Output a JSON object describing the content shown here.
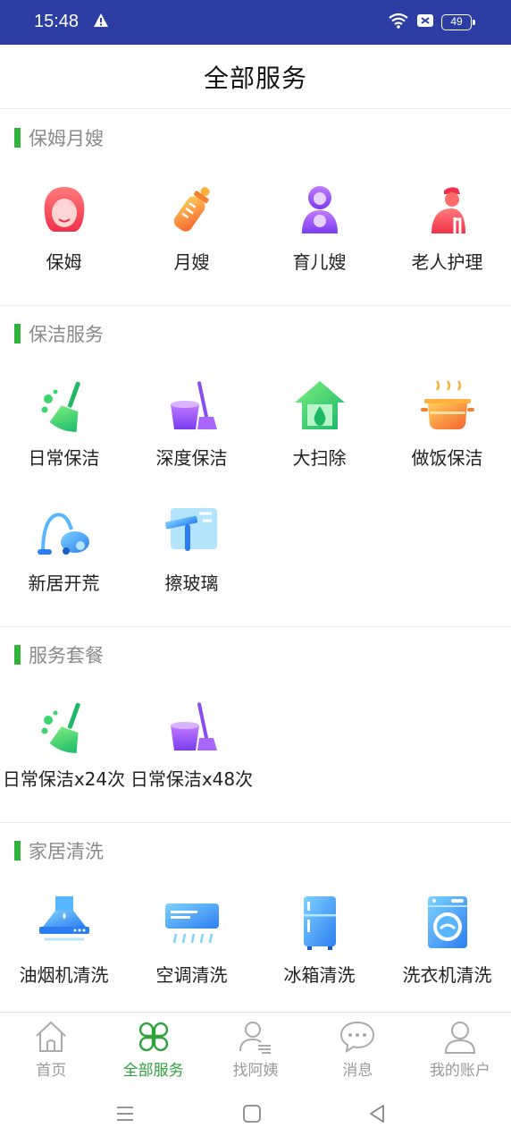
{
  "status": {
    "time": "15:48",
    "battery": "49"
  },
  "page": {
    "title": "全部服务"
  },
  "sections": [
    {
      "title": "保姆月嫂",
      "items": [
        {
          "label": "保姆",
          "icon": "nanny-icon"
        },
        {
          "label": "月嫂",
          "icon": "baby-bottle-icon"
        },
        {
          "label": "育儿嫂",
          "icon": "childcare-icon"
        },
        {
          "label": "老人护理",
          "icon": "elderly-care-icon"
        }
      ]
    },
    {
      "title": "保洁服务",
      "items": [
        {
          "label": "日常保洁",
          "icon": "broom-icon"
        },
        {
          "label": "深度保洁",
          "icon": "bucket-mop-icon"
        },
        {
          "label": "大扫除",
          "icon": "house-drop-icon"
        },
        {
          "label": "做饭保洁",
          "icon": "cooking-pot-icon"
        },
        {
          "label": "新居开荒",
          "icon": "vacuum-icon"
        },
        {
          "label": "擦玻璃",
          "icon": "window-squeegee-icon"
        }
      ]
    },
    {
      "title": "服务套餐",
      "items": [
        {
          "label": "日常保洁x24次",
          "icon": "broom-icon"
        },
        {
          "label": "日常保洁x48次",
          "icon": "bucket-mop-icon"
        }
      ]
    },
    {
      "title": "家居清洗",
      "items": [
        {
          "label": "油烟机清洗",
          "icon": "range-hood-icon"
        },
        {
          "label": "空调清洗",
          "icon": "air-conditioner-icon"
        },
        {
          "label": "冰箱清洗",
          "icon": "fridge-icon"
        },
        {
          "label": "洗衣机清洗",
          "icon": "washing-machine-icon"
        }
      ]
    }
  ],
  "tabs": [
    {
      "label": "首页",
      "icon": "home-icon",
      "active": false
    },
    {
      "label": "全部服务",
      "icon": "clover-icon",
      "active": true
    },
    {
      "label": "找阿姨",
      "icon": "find-person-icon",
      "active": false
    },
    {
      "label": "消息",
      "icon": "chat-bubble-icon",
      "active": false
    },
    {
      "label": "我的账户",
      "icon": "account-icon",
      "active": false
    }
  ],
  "colors": {
    "statusBar": "#2c3ea3",
    "accent": "#2fb33a",
    "activeTab": "#2fa33a",
    "inactiveTab": "#9a9a9a"
  }
}
